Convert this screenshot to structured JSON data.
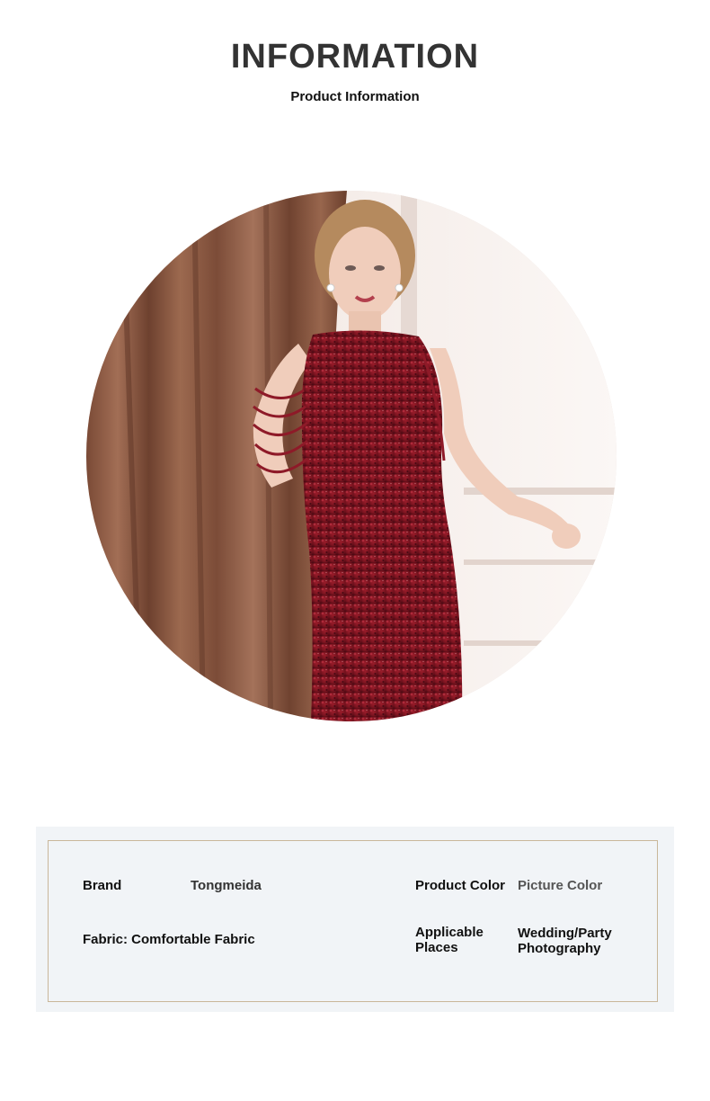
{
  "header": {
    "title": "INFORMATION",
    "subtitle": "Product Information"
  },
  "photo": {
    "subject": "woman-in-burgundy-sequin-dress-icon",
    "colors": {
      "curtain": "#8a5a44",
      "wall": "#f3ebe7",
      "dress": "#7b1420",
      "skin": "#f0cdbb",
      "hair": "#b58a5e"
    }
  },
  "info": {
    "brand_label": "Brand",
    "brand_value": "Tongmeida",
    "color_label": "Product Color",
    "color_value": "Picture Color",
    "fabric_text": "Fabric: Comfortable Fabric",
    "places_label_line1": "Applicable",
    "places_label_line2": "Places",
    "places_value_line1": "Wedding/Party",
    "places_value_line2": "Photography"
  },
  "colors": {
    "panel_background": "#f1f4f7",
    "frame_border": "#c9b79a",
    "title": "#333333"
  }
}
